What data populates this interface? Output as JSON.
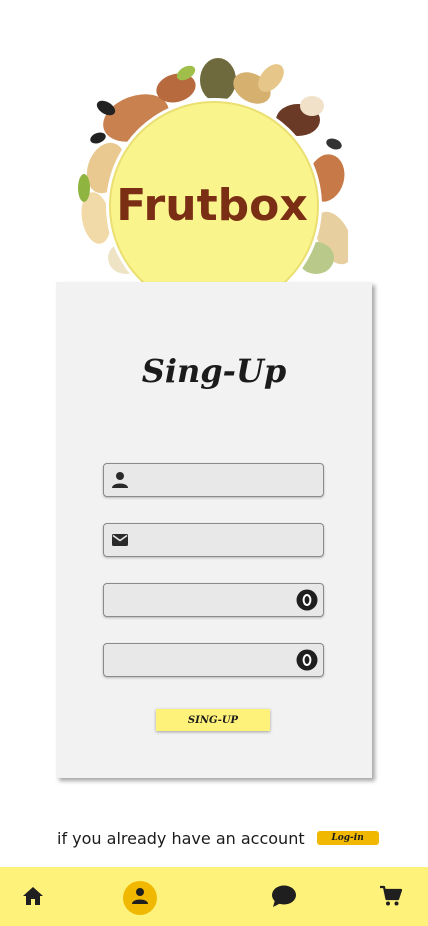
{
  "logo": {
    "text": "Frutbox"
  },
  "signup": {
    "title": "Sing-Up",
    "fields": [
      {
        "name": "username",
        "icon": "person-icon",
        "value": "",
        "placeholder": ""
      },
      {
        "name": "email",
        "icon": "mail-icon",
        "value": "",
        "placeholder": ""
      },
      {
        "name": "password",
        "icon": "eye-toggle-icon",
        "value": "",
        "placeholder": ""
      },
      {
        "name": "confirm-password",
        "icon": "eye-toggle-icon",
        "value": "",
        "placeholder": ""
      }
    ],
    "button_label": "SING-UP"
  },
  "login": {
    "prompt": "if you already have an account",
    "button_label": "Log-in"
  },
  "nav": {
    "items": [
      {
        "icon": "home-icon",
        "active": false
      },
      {
        "icon": "profile-icon",
        "active": true
      },
      {
        "icon": "chat-icon",
        "active": false
      },
      {
        "icon": "cart-icon",
        "active": false
      }
    ]
  },
  "colors": {
    "accent_yellow": "#fff27a",
    "accent_gold": "#f0b800",
    "brand_brown": "#7a2e14",
    "card_bg": "#f2f2f2"
  }
}
